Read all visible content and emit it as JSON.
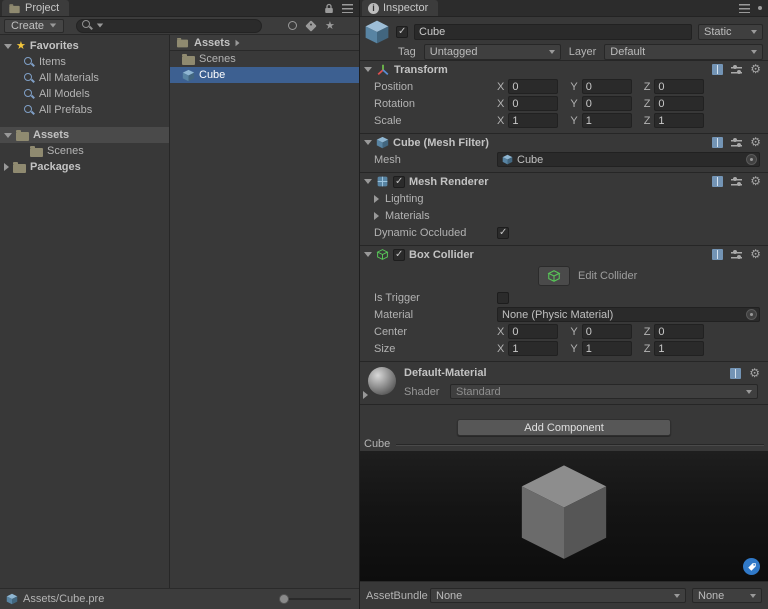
{
  "colors": {
    "selection_blue": "#3d6091",
    "badge_blue": "#3079c8",
    "favorite_star_yellow": "#f3c63c",
    "folder_tan": "#8f8a70"
  },
  "axes": {
    "x": "X",
    "y": "Y",
    "z": "Z"
  },
  "project": {
    "tab_label": "Project",
    "create_label": "Create",
    "favorites_label": "Favorites",
    "favorites": [
      "Items",
      "All Materials",
      "All Models",
      "All Prefabs"
    ],
    "assets_label": "Assets",
    "scenes_label": "Scenes",
    "packages_label": "Packages",
    "browser_path": "Assets",
    "browser_items": [
      {
        "label": "Scenes"
      },
      {
        "label": "Cube"
      }
    ],
    "status_path": "Assets/Cube.pre"
  },
  "inspector": {
    "tab_label": "Inspector",
    "name_value": "Cube",
    "static_label": "Static",
    "tag_label": "Tag",
    "tag_value": "Untagged",
    "layer_label": "Layer",
    "layer_value": "Default",
    "transform": {
      "title": "Transform",
      "rows": [
        {
          "label": "Position",
          "x": "0",
          "y": "0",
          "z": "0"
        },
        {
          "label": "Rotation",
          "x": "0",
          "y": "0",
          "z": "0"
        },
        {
          "label": "Scale",
          "x": "1",
          "y": "1",
          "z": "1"
        }
      ]
    },
    "mesh_filter": {
      "title": "Cube (Mesh Filter)",
      "mesh_label": "Mesh",
      "mesh_value": "Cube"
    },
    "mesh_renderer": {
      "title": "Mesh Renderer",
      "lighting_label": "Lighting",
      "materials_label": "Materials",
      "dynamic_occluded_label": "Dynamic Occluded"
    },
    "box_collider": {
      "title": "Box Collider",
      "edit_collider_label": "Edit Collider",
      "is_trigger_label": "Is Trigger",
      "material_label": "Material",
      "material_value": "None (Physic Material)",
      "rows": [
        {
          "label": "Center",
          "x": "0",
          "y": "0",
          "z": "0"
        },
        {
          "label": "Size",
          "x": "1",
          "y": "1",
          "z": "1"
        }
      ]
    },
    "material": {
      "title": "Default-Material",
      "shader_label": "Shader",
      "shader_value": "Standard"
    },
    "add_component_label": "Add Component",
    "preview_title": "Cube",
    "assetbundle": {
      "label": "AssetBundle",
      "bundle_value": "None",
      "variant_value": "None"
    }
  }
}
